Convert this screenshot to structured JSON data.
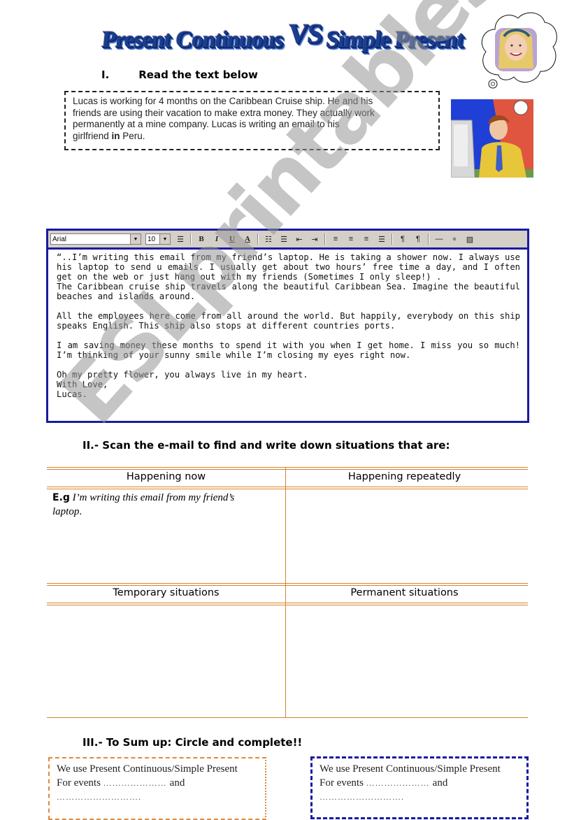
{
  "title": {
    "part1": "Present Continuous",
    "vs": "VS",
    "part2": "Simple Present"
  },
  "section1": {
    "number": "I.",
    "heading": "Read the text below"
  },
  "intro": {
    "line1": "Lucas is working for 4 months on the Caribbean Cruise ship. He and his",
    "line2": "friends are using their vacation to make extra money. They actually work",
    "line3": "permanently at a mine company. Lucas is writing an email to his",
    "line4_pre": "girlfriend ",
    "line4_bold": "in",
    "line4_post": " Peru."
  },
  "illustrations": {
    "thought_bubble": "girlfriend-portrait-icon",
    "man_at_computer": "man-at-computer-icon"
  },
  "email": {
    "toolbar": {
      "font": "Arial",
      "size": "10",
      "bold": "B",
      "italic": "I",
      "underline": "U",
      "font_color": "A"
    },
    "paragraphs": [
      "“..I’m writing this email from my friend’s laptop. He is taking a shower now. I always use his laptop to send u emails.  I usually get about two hours’ free time a day, and I often get on the web or just hang out with my friends (Sometimes I only sleep!) .",
      "The Caribbean cruise ship travels along the beautiful Caribbean Sea. Imagine the beautiful beaches and islands around.",
      "All the employees here come from all around the world. But happily, everybody on this ship speaks English. This ship also stops at different countries ports.",
      "I am saving money these months to spend it with you when I get home. I miss you so much! I’m thinking of your sunny smile while I’m closing my eyes right now.",
      "Oh my pretty flower, you always live in my heart."
    ],
    "closing": "With Love,",
    "signature": "Lucas."
  },
  "section2": {
    "heading": "II.- Scan the e-mail to find and write down situations  that are:"
  },
  "table": {
    "headers_top": [
      "Happening now",
      "Happening repeatedly"
    ],
    "example_label": "E.g",
    "example_text": " I’m writing this email from my friend’s laptop",
    "example_end": ".",
    "headers_bottom": [
      "Temporary situations",
      "Permanent situations"
    ]
  },
  "section3": {
    "heading": "III.- To Sum up: Circle and complete!!"
  },
  "summary_boxes": [
    {
      "line1": "We use Present Continuous/Simple Present",
      "line2_pre": "For events ",
      "line2_dots": "………………… ",
      "line2_post": "and",
      "line3": "………………………."
    },
    {
      "line1": "We use Present Continuous/Simple Present",
      "line2_pre": "For events ",
      "line2_dots": "………………… ",
      "line2_post": "and",
      "line3": "………………………."
    }
  ],
  "watermark": "ESLprintables.com",
  "colors": {
    "email_border": "#1a1aa0",
    "table_lines": "#d9822b",
    "left_box_border": "#e0883a",
    "right_box_border": "#1a1aa0"
  }
}
